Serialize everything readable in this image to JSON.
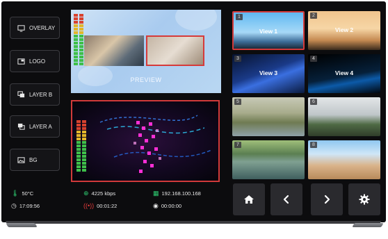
{
  "sidebar": {
    "buttons": [
      {
        "label": "OVERLAY",
        "icon": "monitor-icon"
      },
      {
        "label": "LOGO",
        "icon": "logo-window-icon"
      },
      {
        "label": "LAYER B",
        "icon": "layers-icon"
      },
      {
        "label": "LAYER A",
        "icon": "layers-icon"
      },
      {
        "label": "BG",
        "icon": "image-icon"
      }
    ]
  },
  "preview": {
    "label": "PREVIEW"
  },
  "status": {
    "temperature": "50°C",
    "bitrate": "4225 kbps",
    "ip": "192.168.100.168",
    "clock": "17:09:56",
    "live_time": "00:01:22",
    "record_time": "00:00:00"
  },
  "views": [
    {
      "num": "1",
      "label": "View 1",
      "selected": true
    },
    {
      "num": "2",
      "label": "View 2",
      "selected": false
    },
    {
      "num": "3",
      "label": "View 3",
      "selected": false
    },
    {
      "num": "4",
      "label": "View 4",
      "selected": false
    },
    {
      "num": "5",
      "label": "",
      "selected": false
    },
    {
      "num": "6",
      "label": "",
      "selected": false
    },
    {
      "num": "7",
      "label": "",
      "selected": false
    },
    {
      "num": "8",
      "label": "",
      "selected": false
    }
  ],
  "nav": [
    {
      "icon": "home-icon"
    },
    {
      "icon": "chevron-left-icon"
    },
    {
      "icon": "chevron-right-icon"
    },
    {
      "icon": "gear-icon"
    }
  ],
  "colors": {
    "selected_border": "#d43a3a",
    "temp_icon": "#2ecc71",
    "bitrate_icon": "#2ecc71",
    "ip_icon": "#2ecc71",
    "live_icon": "#e53b3b"
  }
}
